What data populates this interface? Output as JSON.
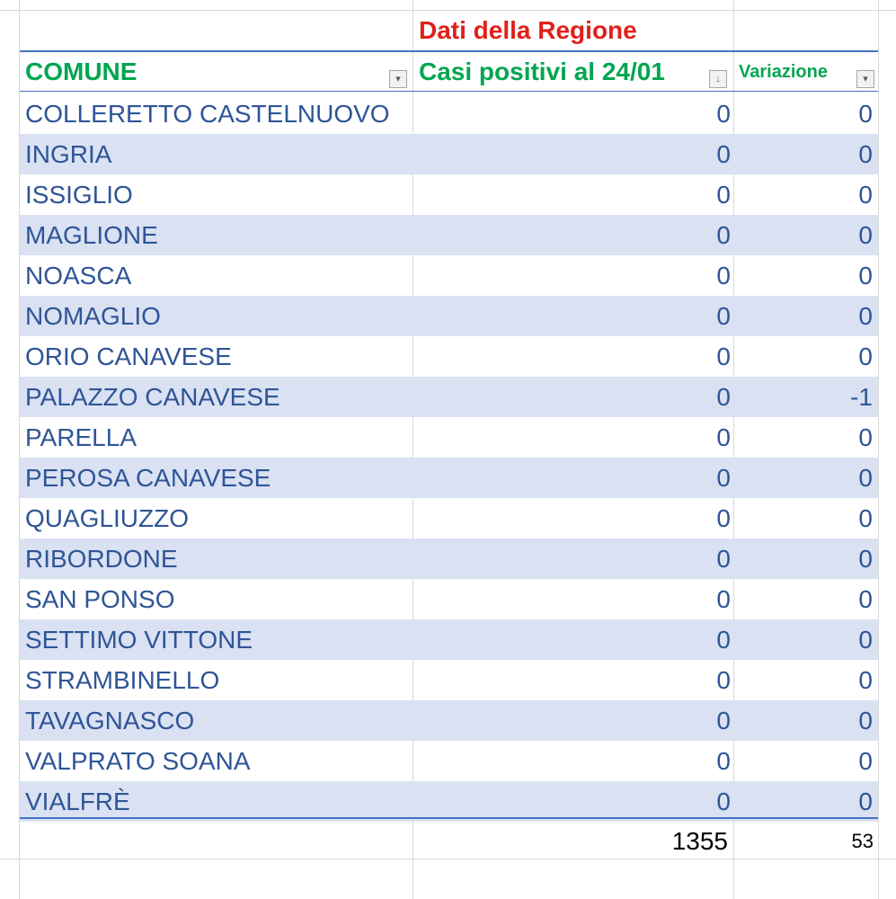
{
  "header": {
    "region_title": "Dati della Regione",
    "col_comune": "COMUNE",
    "col_casi": "Casi positivi al 24/01",
    "col_variazione": "Variazione"
  },
  "icons": {
    "filter": "dropdown-filter-icon",
    "sort_filter": "sort-descending-filter-icon"
  },
  "colors": {
    "region_title": "#e0201a",
    "header_text": "#00a650",
    "cell_text": "#2f5597",
    "band": "#d9e1f2",
    "table_border": "#4472c4"
  },
  "rows": [
    {
      "comune": "COLLERETTO CASTELNUOVO",
      "casi": "0",
      "variazione": "0"
    },
    {
      "comune": "INGRIA",
      "casi": "0",
      "variazione": "0"
    },
    {
      "comune": "ISSIGLIO",
      "casi": "0",
      "variazione": "0"
    },
    {
      "comune": "MAGLIONE",
      "casi": "0",
      "variazione": "0"
    },
    {
      "comune": "NOASCA",
      "casi": "0",
      "variazione": "0"
    },
    {
      "comune": "NOMAGLIO",
      "casi": "0",
      "variazione": "0"
    },
    {
      "comune": "ORIO CANAVESE",
      "casi": "0",
      "variazione": "0"
    },
    {
      "comune": "PALAZZO CANAVESE",
      "casi": "0",
      "variazione": "-1"
    },
    {
      "comune": "PARELLA",
      "casi": "0",
      "variazione": "0"
    },
    {
      "comune": "PEROSA CANAVESE",
      "casi": "0",
      "variazione": "0"
    },
    {
      "comune": "QUAGLIUZZO",
      "casi": "0",
      "variazione": "0"
    },
    {
      "comune": "RIBORDONE",
      "casi": "0",
      "variazione": "0"
    },
    {
      "comune": "SAN PONSO",
      "casi": "0",
      "variazione": "0"
    },
    {
      "comune": "SETTIMO VITTONE",
      "casi": "0",
      "variazione": "0"
    },
    {
      "comune": "STRAMBINELLO",
      "casi": "0",
      "variazione": "0"
    },
    {
      "comune": "TAVAGNASCO",
      "casi": "0",
      "variazione": "0"
    },
    {
      "comune": "VALPRATO SOANA",
      "casi": "0",
      "variazione": "0"
    },
    {
      "comune": "VIALFRÈ",
      "casi": "0",
      "variazione": "0"
    }
  ],
  "totals": {
    "casi": "1355",
    "variazione": "53"
  }
}
